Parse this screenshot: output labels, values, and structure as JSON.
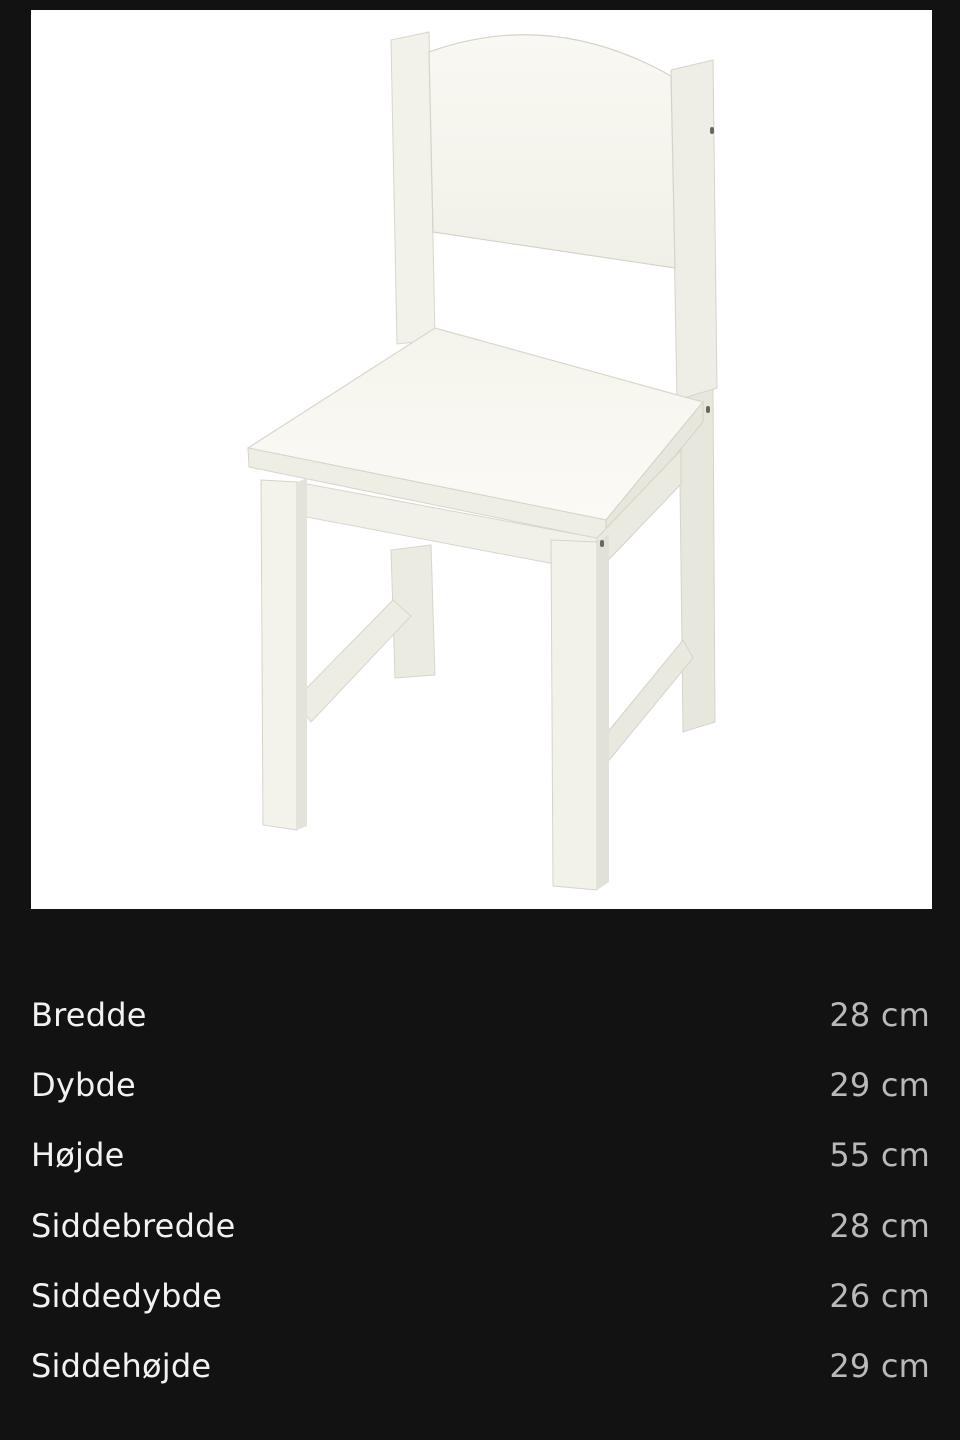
{
  "product": {
    "image": {
      "subject": "chair-illustration",
      "background_color": "#ffffff",
      "chair_color": "#f6f5ee"
    }
  },
  "specs": [
    {
      "label": "Bredde",
      "value": "28 cm"
    },
    {
      "label": "Dybde",
      "value": "29 cm"
    },
    {
      "label": "Højde",
      "value": "55 cm"
    },
    {
      "label": "Siddebredde",
      "value": "28 cm"
    },
    {
      "label": "Siddedybde",
      "value": "26 cm"
    },
    {
      "label": "Siddehøjde",
      "value": "29 cm"
    }
  ],
  "theme": {
    "page_background": "#121212",
    "label_color": "#f2f2f2",
    "value_color": "#b9b9b9"
  }
}
